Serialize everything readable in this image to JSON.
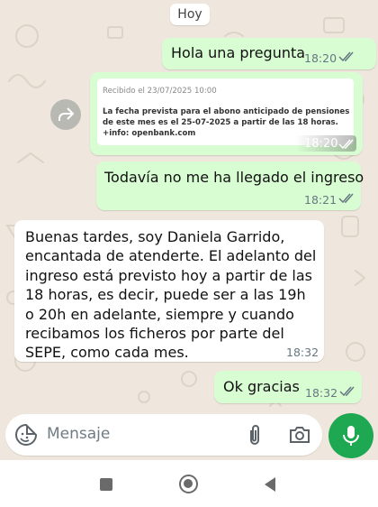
{
  "date_chip": "Hoy",
  "messages": [
    {
      "id": "m1",
      "direction": "outgoing",
      "text": "Hola una pregunta",
      "time": "18:20",
      "status": "read"
    },
    {
      "id": "m2",
      "direction": "outgoing",
      "type": "image",
      "quote": {
        "header": "Recibido el 23/07/2025 10:00",
        "lines": [
          "La fecha prevista para el abono anticipado de pensiones",
          "de este mes es el 25-07-2025 a partir de las 18 horas.",
          "+info: openbank.com"
        ]
      },
      "time": "18:20"
    },
    {
      "id": "m3",
      "direction": "outgoing",
      "text": "Todavía no me ha llegado el ingreso",
      "time": "18:21",
      "status": "read"
    },
    {
      "id": "m4",
      "direction": "incoming",
      "lines": [
        "Buenas tardes, soy Daniela Garrido,",
        "encantada de atenderte. El adelanto del",
        "ingreso está previsto hoy a partir de las",
        "18 horas, es decir, puede ser a las 19h",
        "o 20h en adelante, siempre y cuando",
        "recibamos los ficheros por parte del",
        "SEPE, como cada mes."
      ],
      "time": "18:32"
    },
    {
      "id": "m5",
      "direction": "outgoing",
      "text": "Ok gracias",
      "time": "18:32",
      "status": "read"
    }
  ],
  "composer": {
    "placeholder": "Mensaje",
    "icons": [
      "sticker-icon",
      "paperclip-icon",
      "camera-icon",
      "mic-icon"
    ]
  },
  "colors": {
    "outgoing_bubble": "#d9fdd3",
    "incoming_bubble": "#ffffff",
    "read_ticks": "#53bdeb",
    "accent": "#1da851",
    "chat_background": "#efe7dd"
  },
  "navbar": {
    "icons": [
      "recents-square-icon",
      "home-circle-icon",
      "back-triangle-icon"
    ]
  }
}
